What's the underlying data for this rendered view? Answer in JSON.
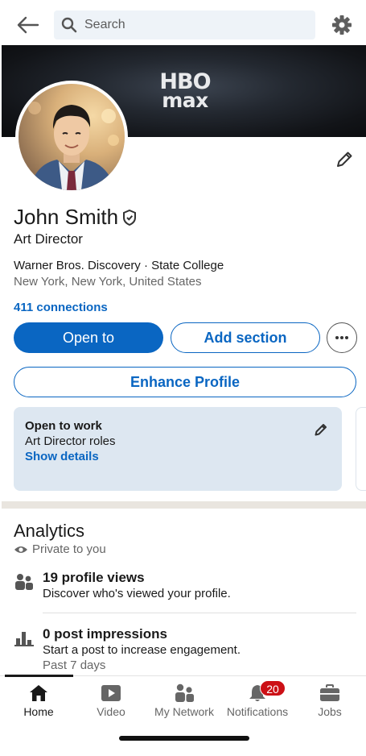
{
  "search": {
    "placeholder": "Search"
  },
  "banner": {
    "logo_line1": "HBO",
    "logo_line2": "max"
  },
  "profile": {
    "name": "John Smith",
    "headline": "Art Director",
    "company_line": "Warner Bros. Discovery · State College",
    "location": "New York, New York, United States",
    "connections": "411 connections"
  },
  "actions": {
    "open_to": "Open to",
    "add_section": "Add section",
    "enhance_profile": "Enhance Profile"
  },
  "open_to_work": {
    "title": "Open to work",
    "roles": "Art Director roles",
    "link": "Show details"
  },
  "analytics": {
    "title": "Analytics",
    "visibility": "Private to you",
    "items": [
      {
        "icon": "people-icon",
        "title": "19 profile views",
        "subtitle": "Discover who's viewed your profile.",
        "note": ""
      },
      {
        "icon": "bar-chart-icon",
        "title": "0 post impressions",
        "subtitle": "Start a post to increase engagement.",
        "note": "Past 7 days"
      }
    ]
  },
  "nav": {
    "items": [
      {
        "label": "Home",
        "icon": "home-icon",
        "active": true
      },
      {
        "label": "Video",
        "icon": "video-icon",
        "active": false
      },
      {
        "label": "My Network",
        "icon": "network-icon",
        "active": false
      },
      {
        "label": "Notifications",
        "icon": "bell-icon",
        "active": false,
        "badge": "20"
      },
      {
        "label": "Jobs",
        "icon": "briefcase-icon",
        "active": false
      }
    ]
  },
  "colors": {
    "accent": "#0a66c2",
    "badge": "#cc1016",
    "card": "#dde7f1"
  }
}
